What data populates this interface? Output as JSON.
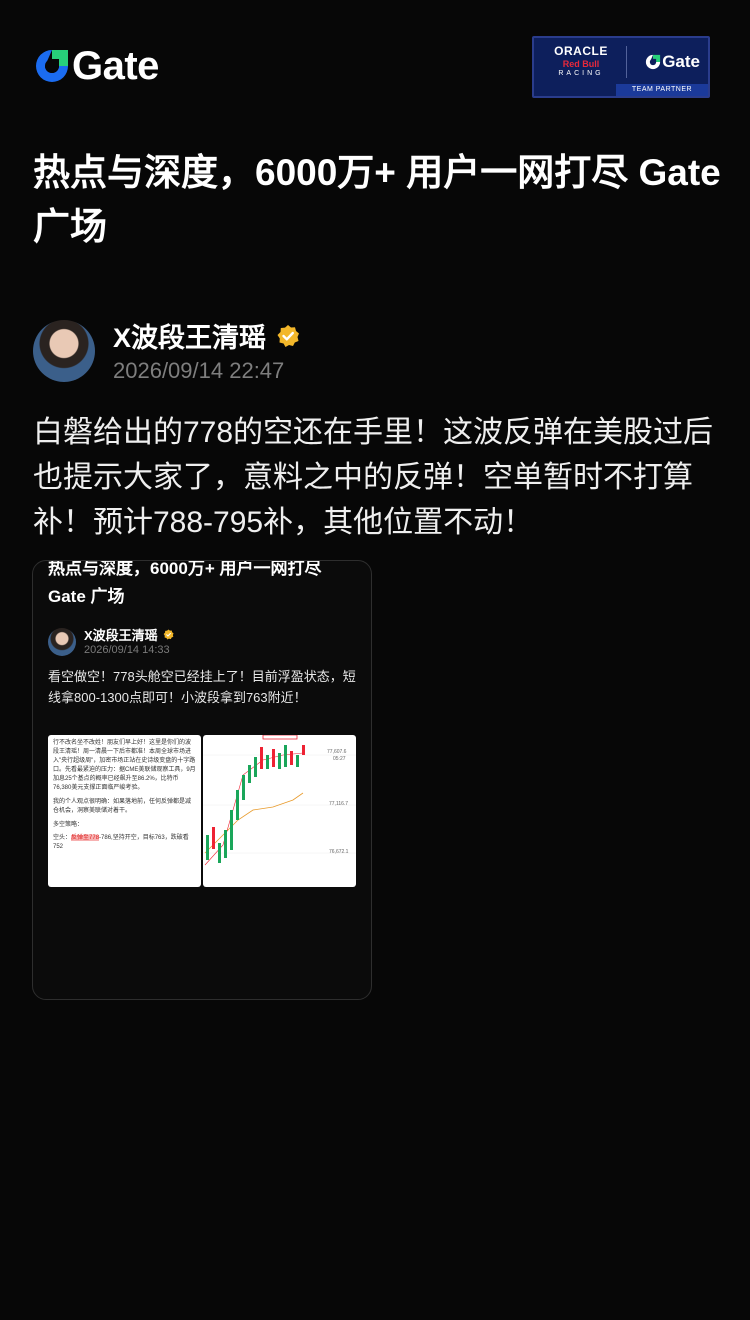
{
  "brand": {
    "logo_text": "Gate",
    "accent_blue": "#1b6cf0",
    "accent_green": "#27d07a",
    "partner_badge": {
      "oracle": "ORACLE",
      "redbull": "Red Bull",
      "racing": "RACING",
      "gate": "Gate",
      "team": "TEAM PARTNER"
    }
  },
  "headline": "热点与深度，6000万+ 用户一网打尽 Gate 广场",
  "post": {
    "author": "X波段王清瑶",
    "verified_icon": "verified-badge-icon",
    "timestamp": "2026/09/14 22:47",
    "text": "白磐给出的778的空还在手里！这波反弹在美股过后也提示大家了，意料之中的反弹！空单暂时不打算补！预计788-795补，其他位置不动！"
  },
  "embed": {
    "title_line1": "热点与深度，6000万+ 用户一网打尽",
    "title_line2": "Gate 广场",
    "author": "X波段王清瑶",
    "timestamp": "2026/09/14 14:33",
    "text": "看空做空！778头舱空已经挂上了！目前浮盈状态，短线拿800-1300点即可！小波段拿到763附近！",
    "note_text_1": "行不改名坐不改姓！朋友们早上好！这里是你们的波段王清瑶！周一清晨一下后市都准！本周全球市场进入\"央行超级周\"，加密市场正站在史诗级变盘的十字路口。先看最紧迫的压力：据CME美联储观察工具，9月加息25个基点的概率已经飙升至86.2%，比特币76,380美元支撑正面临严峻考验。",
    "note_text_2": "我的个人观点很明确：如果落地前，任何反弹都是减仓机会，洞察美联储对着干。",
    "note_text_3": "多空策略：",
    "note_prefix": "空头：",
    "note_highlight": "反弹至778",
    "note_suffix": "-786,坚持开空，目标763，跌破看752",
    "chart_labels": [
      "77,607.6",
      "05:27",
      "77,116.7",
      "76,672.1"
    ]
  }
}
